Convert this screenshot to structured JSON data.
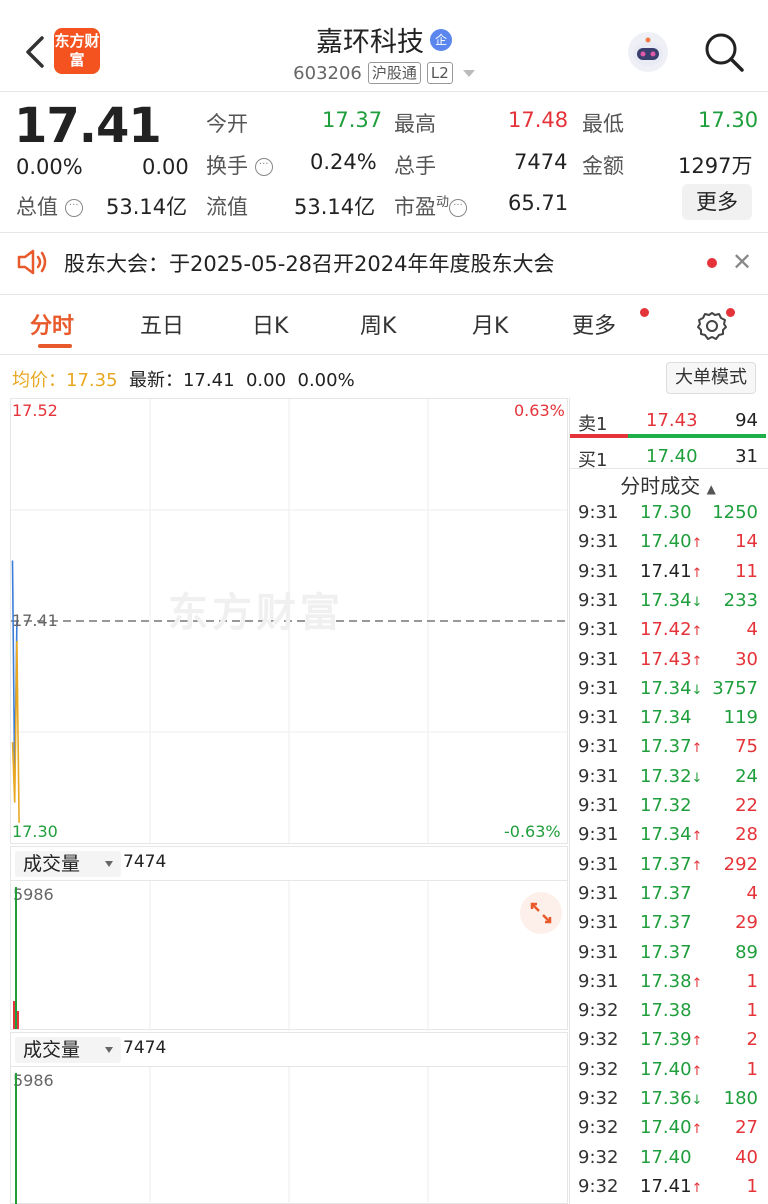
{
  "header": {
    "logo_text": "东方财富",
    "stock_name": "嘉环科技",
    "enterprise_badge": "企",
    "code": "603206",
    "tag_connect": "沪股通",
    "tag_level": "L2"
  },
  "quote": {
    "price": "17.41",
    "change_pct": "0.00%",
    "change": "0.00",
    "open_label": "今开",
    "open": "17.37",
    "high_label": "最高",
    "high": "17.48",
    "low_label": "最低",
    "low": "17.30",
    "turnover_label": "换手",
    "turnover": "0.24%",
    "volume_label": "总手",
    "volume": "7474",
    "amount_label": "金额",
    "amount": "1297万",
    "mktcap_label": "总值",
    "mktcap": "53.14亿",
    "float_label": "流值",
    "float_cap": "53.14亿",
    "pe_label": "市盈",
    "pe_sup": "动",
    "pe": "65.71",
    "more_label": "更多"
  },
  "notice": {
    "text": "股东大会：于2025-05-28召开2024年年度股东大会"
  },
  "tabs": [
    "分时",
    "五日",
    "日K",
    "周K",
    "月K",
    "更多"
  ],
  "info": {
    "avg_label": "均价：",
    "avg": "17.35",
    "latest_label": "最新：",
    "latest": "17.41",
    "change": "0.00",
    "change_pct": "0.00%",
    "big_order_btn": "大单模式"
  },
  "chart_data": {
    "type": "line",
    "y_max_label": "17.52",
    "y_min_label": "17.30",
    "pct_max_label": "0.63%",
    "pct_min_label": "-0.63%",
    "ref_label": "17.41",
    "ylim": [
      17.3,
      17.52
    ],
    "reference_price": 17.41,
    "series": [
      {
        "values": [
          17.44,
          17.33,
          17.41
        ]
      },
      {
        "values": [
          17.35,
          17.32,
          17.4,
          17.31
        ]
      }
    ],
    "watermark": "东方财富"
  },
  "volume_panels": [
    {
      "label": "成交量",
      "value": "7474",
      "max_label": "5986"
    },
    {
      "label": "成交量",
      "value": "7474",
      "max_label": "5986"
    }
  ],
  "order_book": {
    "ask_label": "卖1",
    "ask_price": "17.43",
    "ask_vol": "94",
    "bid_label": "买1",
    "bid_price": "17.40",
    "bid_vol": "31"
  },
  "trades_header": "分时成交",
  "trades": [
    {
      "time": "9:31",
      "price": "17.30",
      "arrow": "",
      "vol": "1250",
      "pc": "green",
      "vc": "green"
    },
    {
      "time": "9:31",
      "price": "17.40",
      "arrow": "↑",
      "vol": "14",
      "pc": "green",
      "vc": "red"
    },
    {
      "time": "9:31",
      "price": "17.41",
      "arrow": "↑",
      "vol": "11",
      "pc": "black",
      "vc": "red"
    },
    {
      "time": "9:31",
      "price": "17.34",
      "arrow": "↓",
      "vol": "233",
      "pc": "green",
      "vc": "green"
    },
    {
      "time": "9:31",
      "price": "17.42",
      "arrow": "↑",
      "vol": "4",
      "pc": "red",
      "vc": "red"
    },
    {
      "time": "9:31",
      "price": "17.43",
      "arrow": "↑",
      "vol": "30",
      "pc": "red",
      "vc": "red"
    },
    {
      "time": "9:31",
      "price": "17.34",
      "arrow": "↓",
      "vol": "3757",
      "pc": "green",
      "vc": "green"
    },
    {
      "time": "9:31",
      "price": "17.34",
      "arrow": "",
      "vol": "119",
      "pc": "green",
      "vc": "green"
    },
    {
      "time": "9:31",
      "price": "17.37",
      "arrow": "↑",
      "vol": "75",
      "pc": "green",
      "vc": "red"
    },
    {
      "time": "9:31",
      "price": "17.32",
      "arrow": "↓",
      "vol": "24",
      "pc": "green",
      "vc": "green"
    },
    {
      "time": "9:31",
      "price": "17.32",
      "arrow": "",
      "vol": "22",
      "pc": "green",
      "vc": "red"
    },
    {
      "time": "9:31",
      "price": "17.34",
      "arrow": "↑",
      "vol": "28",
      "pc": "green",
      "vc": "red"
    },
    {
      "time": "9:31",
      "price": "17.37",
      "arrow": "↑",
      "vol": "292",
      "pc": "green",
      "vc": "red"
    },
    {
      "time": "9:31",
      "price": "17.37",
      "arrow": "",
      "vol": "4",
      "pc": "green",
      "vc": "red"
    },
    {
      "time": "9:31",
      "price": "17.37",
      "arrow": "",
      "vol": "29",
      "pc": "green",
      "vc": "red"
    },
    {
      "time": "9:31",
      "price": "17.37",
      "arrow": "",
      "vol": "89",
      "pc": "green",
      "vc": "green"
    },
    {
      "time": "9:31",
      "price": "17.38",
      "arrow": "↑",
      "vol": "1",
      "pc": "green",
      "vc": "red"
    },
    {
      "time": "9:32",
      "price": "17.38",
      "arrow": "",
      "vol": "1",
      "pc": "green",
      "vc": "red"
    },
    {
      "time": "9:32",
      "price": "17.39",
      "arrow": "↑",
      "vol": "2",
      "pc": "green",
      "vc": "red"
    },
    {
      "time": "9:32",
      "price": "17.40",
      "arrow": "↑",
      "vol": "1",
      "pc": "green",
      "vc": "red"
    },
    {
      "time": "9:32",
      "price": "17.36",
      "arrow": "↓",
      "vol": "180",
      "pc": "green",
      "vc": "green"
    },
    {
      "time": "9:32",
      "price": "17.40",
      "arrow": "↑",
      "vol": "27",
      "pc": "green",
      "vc": "red"
    },
    {
      "time": "9:32",
      "price": "17.40",
      "arrow": "",
      "vol": "40",
      "pc": "green",
      "vc": "red"
    },
    {
      "time": "9:32",
      "price": "17.41",
      "arrow": "↑",
      "vol": "1",
      "pc": "black",
      "vc": "red"
    }
  ],
  "colors": {
    "up": "#e5333a",
    "down": "#1f9e3c",
    "accent": "#e85a2c",
    "avg_line": "#e9a822",
    "price_line": "#3b7dd8"
  }
}
